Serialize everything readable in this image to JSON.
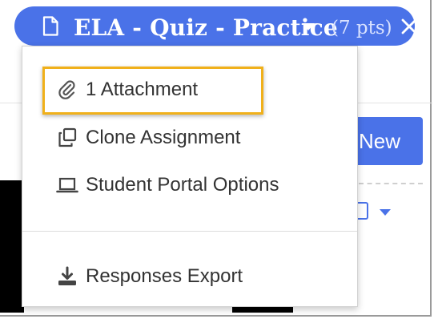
{
  "header": {
    "title": "ELA - Quiz - Practice",
    "points": "(7 pts)",
    "icon": "document-icon",
    "close_icon": "close-icon",
    "accent": "#4a72e8"
  },
  "menu": {
    "items": [
      {
        "label": "1 Attachment",
        "icon": "paperclip-icon",
        "highlighted": true
      },
      {
        "label": "Clone Assignment",
        "icon": "clone-icon"
      },
      {
        "label": "Student Portal Options",
        "icon": "laptop-icon"
      },
      {
        "label": "Responses Export",
        "icon": "download-icon"
      }
    ],
    "highlight_color": "#f0b01a"
  },
  "background": {
    "new_button_label": "New"
  }
}
